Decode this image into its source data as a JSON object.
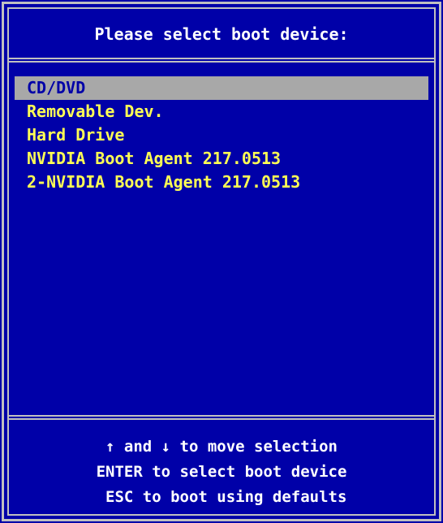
{
  "title": "Please select boot device:",
  "devices": [
    {
      "label": "CD/DVD",
      "selected": true
    },
    {
      "label": "Removable Dev.",
      "selected": false
    },
    {
      "label": "Hard Drive",
      "selected": false
    },
    {
      "label": "NVIDIA Boot Agent 217.0513",
      "selected": false
    },
    {
      "label": "2-NVIDIA Boot Agent 217.0513",
      "selected": false
    }
  ],
  "help": [
    "↑ and ↓ to move selection",
    "ENTER to select boot device",
    " ESC to boot using defaults"
  ],
  "colors": {
    "background": "#0000a8",
    "frame": "#c0c0c0",
    "item_text": "#ffff54",
    "selected_bg": "#a8a8a8",
    "selected_text": "#0000a8",
    "title_text": "#ffffff"
  }
}
